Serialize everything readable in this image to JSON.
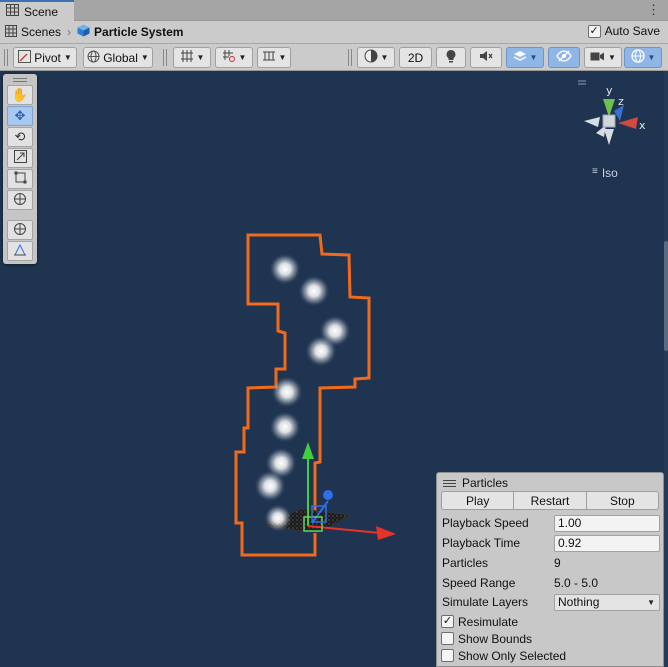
{
  "tab": {
    "label": "Scene"
  },
  "breadcrumb": {
    "scenes": "Scenes",
    "current": "Particle System"
  },
  "autosave": {
    "label": "Auto Save",
    "checked": true
  },
  "toolbar": {
    "pivot": "Pivot",
    "global": "Global",
    "mode_2d": "2D"
  },
  "tools": [
    "hand-tool",
    "move-tool",
    "rotate-tool",
    "scale-tool",
    "rect-tool",
    "transform-tool",
    "custom-tool",
    "editor-tool"
  ],
  "gizmo": {
    "y": "y",
    "z": "z",
    "x": "x",
    "view": "Iso"
  },
  "particles_panel": {
    "title": "Particles",
    "buttons": {
      "play": "Play",
      "restart": "Restart",
      "stop": "Stop"
    },
    "playback_speed": {
      "label": "Playback Speed",
      "value": "1.00"
    },
    "playback_time": {
      "label": "Playback Time",
      "value": "0.92"
    },
    "particles": {
      "label": "Particles",
      "value": "9"
    },
    "speed_range": {
      "label": "Speed Range",
      "value": "5.0 - 5.0"
    },
    "simulate_layers": {
      "label": "Simulate Layers",
      "value": "Nothing"
    },
    "resimulate": {
      "label": "Resimulate",
      "checked": true
    },
    "show_bounds": {
      "label": "Show Bounds",
      "checked": false
    },
    "show_only_selected": {
      "label": "Show Only Selected",
      "checked": false
    }
  },
  "colors": {
    "viewport_bg": "#1f3450",
    "selection_outline": "#f26a1b",
    "axis_x": "#e8322a",
    "axis_y": "#3fcf3f",
    "axis_z": "#2f6fe8"
  }
}
